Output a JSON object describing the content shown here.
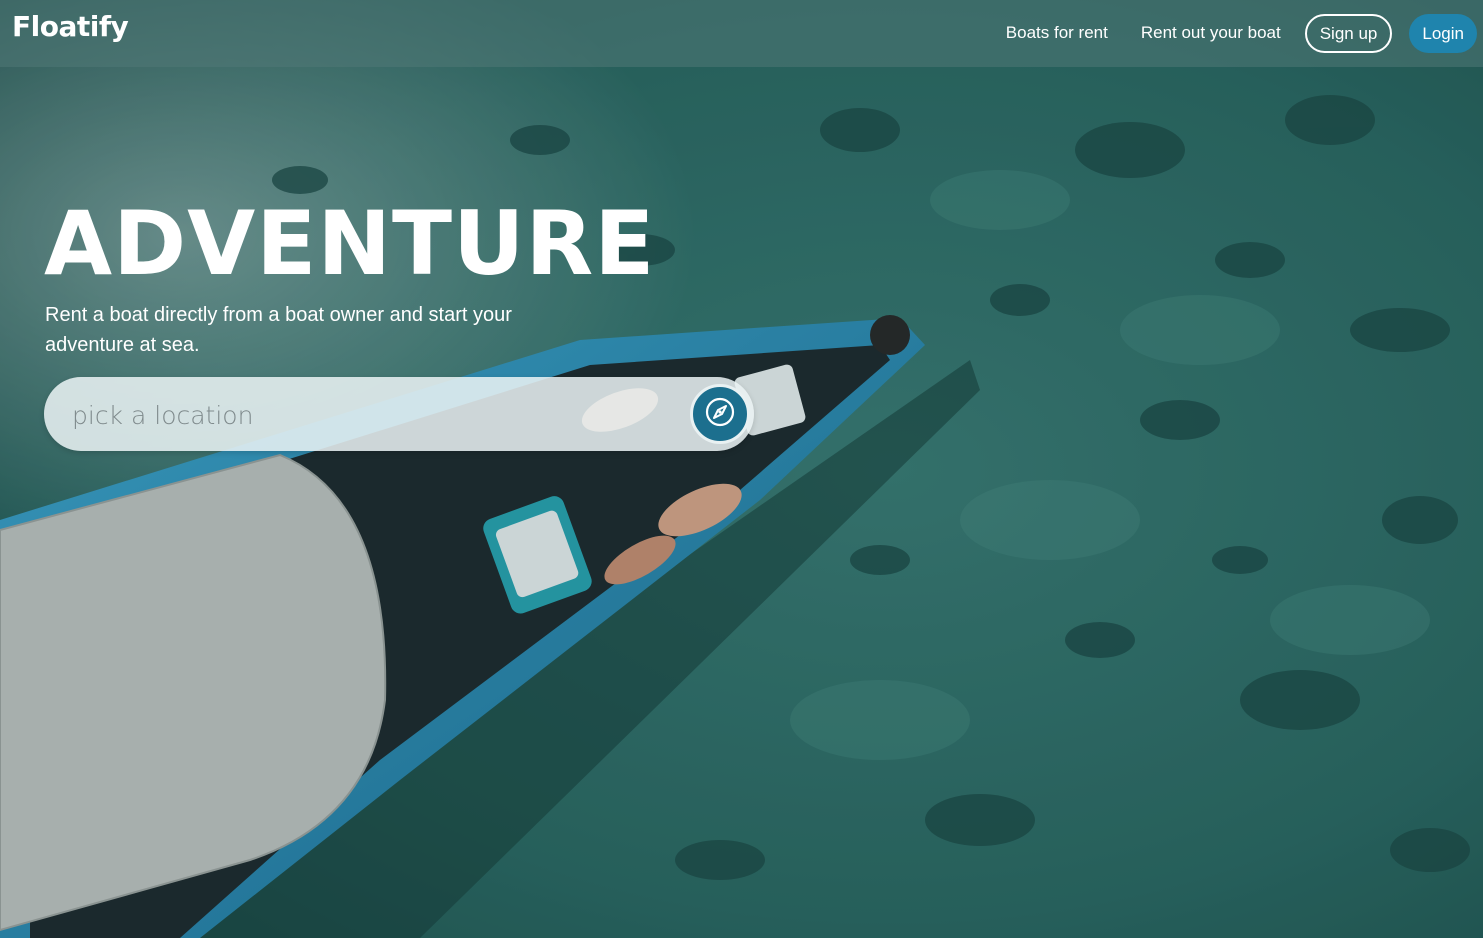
{
  "brand": {
    "name": "Floatify"
  },
  "nav": {
    "boats_for_rent": "Boats for rent",
    "rent_out_your_boat": "Rent out your boat",
    "sign_up": "Sign up",
    "login": "Login"
  },
  "hero": {
    "title": "ADVENTURE",
    "subtitle": "Rent a boat directly from a boat owner and start your adventure at sea."
  },
  "search": {
    "placeholder": "pick a location",
    "button_icon": "compass-icon"
  },
  "colors": {
    "accent": "#1f84ad",
    "search_button": "#1c6f8e",
    "water": "#2b6a66"
  }
}
